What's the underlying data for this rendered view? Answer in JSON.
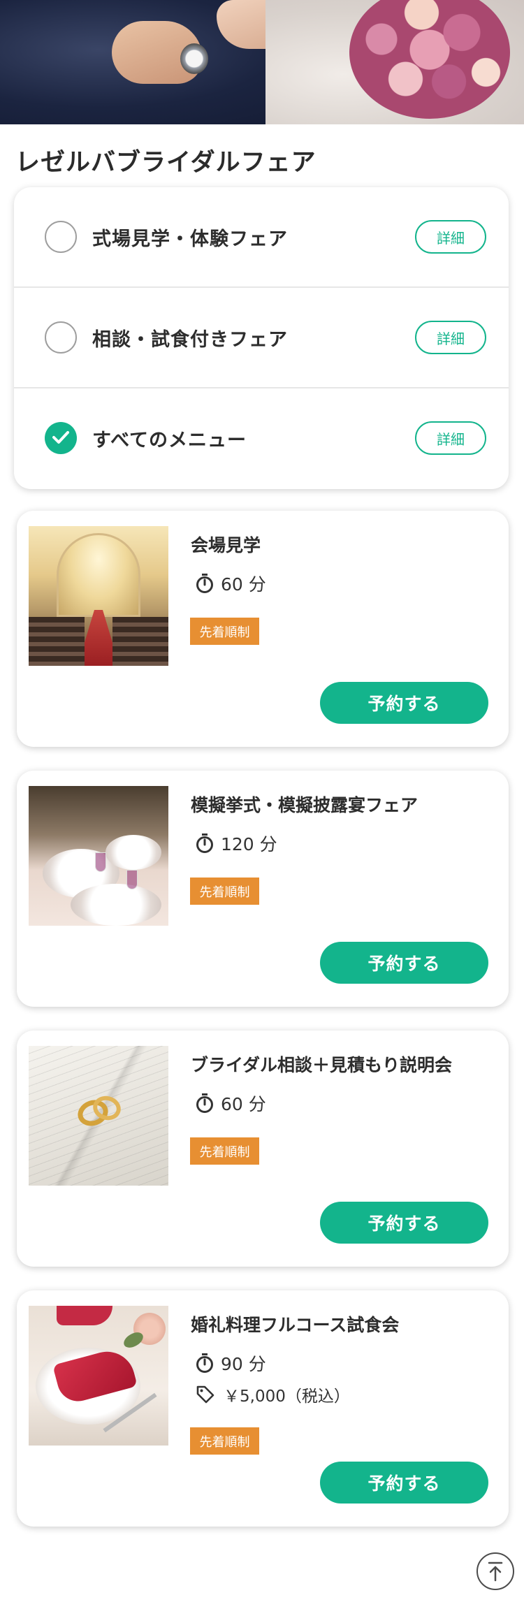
{
  "page_title": "レゼルバブライダルフェア",
  "filters": [
    {
      "label": "式場見学・体験フェア",
      "checked": false,
      "detail_label": "詳細"
    },
    {
      "label": "相談・試食付きフェア",
      "checked": false,
      "detail_label": "詳細"
    },
    {
      "label": "すべてのメニュー",
      "checked": true,
      "detail_label": "詳細"
    }
  ],
  "menus": [
    {
      "title": "会場見学",
      "duration": "60 分",
      "price": null,
      "badge": "先着順制",
      "reserve_label": "予約する",
      "thumb": "chapel-photo"
    },
    {
      "title": "模擬挙式・模擬披露宴フェア",
      "duration": "120 分",
      "price": null,
      "badge": "先着順制",
      "reserve_label": "予約する",
      "thumb": "banquet-photo"
    },
    {
      "title": "ブライダル相談＋見積もり説明会",
      "duration": "60 分",
      "price": null,
      "badge": "先着順制",
      "reserve_label": "予約する",
      "thumb": "rings-book-photo"
    },
    {
      "title": "婚礼料理フルコース試食会",
      "duration": "90 分",
      "price": "￥5,000（税込）",
      "badge": "先着順制",
      "reserve_label": "予約する",
      "thumb": "dinner-table-photo"
    }
  ],
  "colors": {
    "accent": "#13b48c",
    "badge": "#e78f32",
    "text": "#2d2d2d"
  },
  "icons": {
    "timer": "stopwatch-icon",
    "price": "price-tag-icon",
    "check": "checkmark-icon",
    "scroll_top": "arrow-up-to-top-icon"
  }
}
